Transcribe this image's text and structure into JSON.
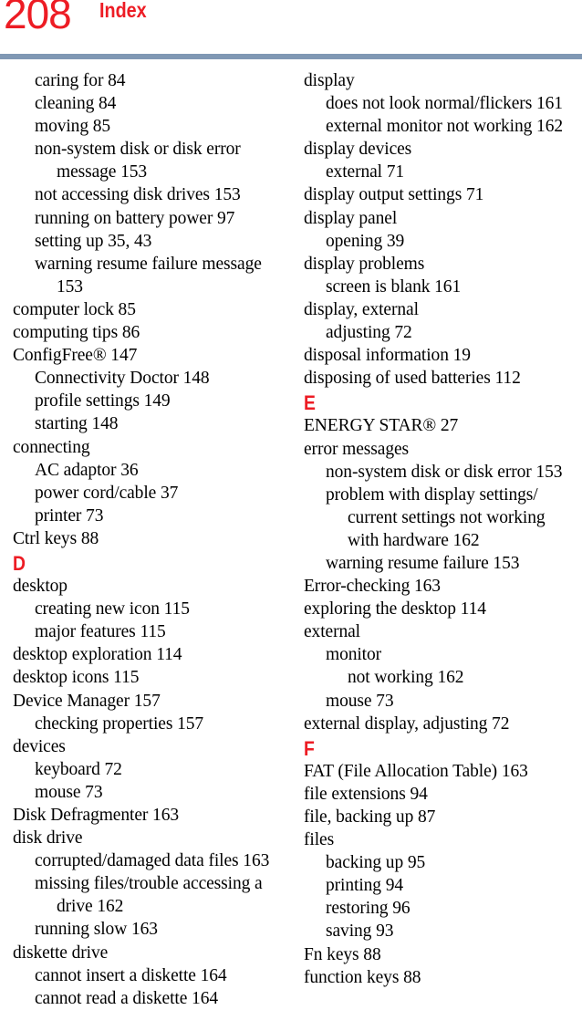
{
  "header": {
    "folio": "208",
    "running_head": "Index",
    "folio_color": "#ed1c24",
    "rule_color": "#8098b4"
  },
  "columns": [
    {
      "name": "left",
      "blocks": [
        {
          "kind": "entry",
          "level": 1,
          "text": "caring for 84",
          "wrapped": false
        },
        {
          "kind": "entry",
          "level": 1,
          "text": "cleaning 84",
          "wrapped": false
        },
        {
          "kind": "entry",
          "level": 1,
          "text": "moving 85",
          "wrapped": false
        },
        {
          "kind": "entry",
          "level": 1,
          "text": "non-system disk or disk error",
          "wrapped": true
        },
        {
          "kind": "cont",
          "level": 1,
          "text": "message 153",
          "wrapped": false
        },
        {
          "kind": "entry",
          "level": 1,
          "text": "not accessing disk drives 153",
          "wrapped": false
        },
        {
          "kind": "entry",
          "level": 1,
          "text": "running on battery power 97",
          "wrapped": false
        },
        {
          "kind": "entry",
          "level": 1,
          "text": "setting up 35, 43",
          "wrapped": false
        },
        {
          "kind": "entry",
          "level": 1,
          "text": "warning resume failure message",
          "wrapped": true
        },
        {
          "kind": "cont",
          "level": 1,
          "text": "153",
          "wrapped": false
        },
        {
          "kind": "entry",
          "level": 0,
          "text": "computer lock 85",
          "wrapped": false
        },
        {
          "kind": "entry",
          "level": 0,
          "text": "computing tips 86",
          "wrapped": false
        },
        {
          "kind": "entry",
          "level": 0,
          "text": "ConfigFree® 147",
          "wrapped": false
        },
        {
          "kind": "entry",
          "level": 1,
          "text": "Connectivity Doctor 148",
          "wrapped": false
        },
        {
          "kind": "entry",
          "level": 1,
          "text": "profile settings 149",
          "wrapped": false
        },
        {
          "kind": "entry",
          "level": 1,
          "text": "starting 148",
          "wrapped": false
        },
        {
          "kind": "entry",
          "level": 0,
          "text": "connecting",
          "wrapped": false
        },
        {
          "kind": "entry",
          "level": 1,
          "text": "AC adaptor 36",
          "wrapped": false
        },
        {
          "kind": "entry",
          "level": 1,
          "text": "power cord/cable 37",
          "wrapped": false
        },
        {
          "kind": "entry",
          "level": 1,
          "text": "printer 73",
          "wrapped": false
        },
        {
          "kind": "entry",
          "level": 0,
          "text": "Ctrl keys 88",
          "wrapped": false
        },
        {
          "kind": "letter",
          "level": 0,
          "text": "D",
          "wrapped": false
        },
        {
          "kind": "entry",
          "level": 0,
          "text": "desktop",
          "wrapped": false
        },
        {
          "kind": "entry",
          "level": 1,
          "text": "creating new icon 115",
          "wrapped": false
        },
        {
          "kind": "entry",
          "level": 1,
          "text": "major features 115",
          "wrapped": false
        },
        {
          "kind": "entry",
          "level": 0,
          "text": "desktop exploration 114",
          "wrapped": false
        },
        {
          "kind": "entry",
          "level": 0,
          "text": "desktop icons 115",
          "wrapped": false
        },
        {
          "kind": "entry",
          "level": 0,
          "text": "Device Manager 157",
          "wrapped": false
        },
        {
          "kind": "entry",
          "level": 1,
          "text": "checking properties 157",
          "wrapped": false
        },
        {
          "kind": "entry",
          "level": 0,
          "text": "devices",
          "wrapped": false
        },
        {
          "kind": "entry",
          "level": 1,
          "text": "keyboard 72",
          "wrapped": false
        },
        {
          "kind": "entry",
          "level": 1,
          "text": "mouse 73",
          "wrapped": false
        },
        {
          "kind": "entry",
          "level": 0,
          "text": "Disk Defragmenter 163",
          "wrapped": false
        },
        {
          "kind": "entry",
          "level": 0,
          "text": "disk drive",
          "wrapped": false
        },
        {
          "kind": "entry",
          "level": 1,
          "text": "corrupted/damaged data files 163",
          "wrapped": false
        },
        {
          "kind": "entry",
          "level": 1,
          "text": "missing files/trouble accessing a",
          "wrapped": true
        },
        {
          "kind": "cont",
          "level": 1,
          "text": "drive 162",
          "wrapped": false
        },
        {
          "kind": "entry",
          "level": 1,
          "text": "running slow 163",
          "wrapped": false
        },
        {
          "kind": "entry",
          "level": 0,
          "text": "diskette drive",
          "wrapped": false
        },
        {
          "kind": "entry",
          "level": 1,
          "text": "cannot insert a diskette 164",
          "wrapped": false
        },
        {
          "kind": "entry",
          "level": 1,
          "text": "cannot read a diskette 164",
          "wrapped": false
        }
      ]
    },
    {
      "name": "right",
      "blocks": [
        {
          "kind": "entry",
          "level": 0,
          "text": "display",
          "wrapped": false
        },
        {
          "kind": "entry",
          "level": 1,
          "text": "does not look normal/flickers 161",
          "wrapped": false
        },
        {
          "kind": "entry",
          "level": 1,
          "text": "external monitor not working 162",
          "wrapped": false
        },
        {
          "kind": "entry",
          "level": 0,
          "text": "display devices",
          "wrapped": false
        },
        {
          "kind": "entry",
          "level": 1,
          "text": "external 71",
          "wrapped": false
        },
        {
          "kind": "entry",
          "level": 0,
          "text": "display output settings 71",
          "wrapped": false
        },
        {
          "kind": "entry",
          "level": 0,
          "text": "display panel",
          "wrapped": false
        },
        {
          "kind": "entry",
          "level": 1,
          "text": "opening 39",
          "wrapped": false
        },
        {
          "kind": "entry",
          "level": 0,
          "text": "display problems",
          "wrapped": false
        },
        {
          "kind": "entry",
          "level": 1,
          "text": "screen is blank 161",
          "wrapped": false
        },
        {
          "kind": "entry",
          "level": 0,
          "text": "display, external",
          "wrapped": false
        },
        {
          "kind": "entry",
          "level": 1,
          "text": "adjusting 72",
          "wrapped": false
        },
        {
          "kind": "entry",
          "level": 0,
          "text": "disposal information 19",
          "wrapped": false
        },
        {
          "kind": "entry",
          "level": 0,
          "text": "disposing of used batteries 112",
          "wrapped": false
        },
        {
          "kind": "letter",
          "level": 0,
          "text": "E",
          "wrapped": false
        },
        {
          "kind": "entry",
          "level": 0,
          "text": "ENERGY STAR® 27",
          "wrapped": false
        },
        {
          "kind": "entry",
          "level": 0,
          "text": "error messages",
          "wrapped": false
        },
        {
          "kind": "entry",
          "level": 1,
          "text": "non-system disk or disk error 153",
          "wrapped": false
        },
        {
          "kind": "entry",
          "level": 1,
          "text": "problem with display settings/",
          "wrapped": true
        },
        {
          "kind": "cont",
          "level": 1,
          "text": "current settings not working",
          "wrapped": true
        },
        {
          "kind": "cont",
          "level": 1,
          "text": "with hardware 162",
          "wrapped": false
        },
        {
          "kind": "entry",
          "level": 1,
          "text": "warning resume failure 153",
          "wrapped": false
        },
        {
          "kind": "entry",
          "level": 0,
          "text": "Error-checking 163",
          "wrapped": false
        },
        {
          "kind": "entry",
          "level": 0,
          "text": "exploring the desktop 114",
          "wrapped": false
        },
        {
          "kind": "entry",
          "level": 0,
          "text": "external",
          "wrapped": false
        },
        {
          "kind": "entry",
          "level": 1,
          "text": "monitor",
          "wrapped": false
        },
        {
          "kind": "entry",
          "level": 2,
          "text": "not working 162",
          "wrapped": false
        },
        {
          "kind": "entry",
          "level": 1,
          "text": "mouse 73",
          "wrapped": false
        },
        {
          "kind": "entry",
          "level": 0,
          "text": "external display, adjusting 72",
          "wrapped": false
        },
        {
          "kind": "letter",
          "level": 0,
          "text": "F",
          "wrapped": false
        },
        {
          "kind": "entry",
          "level": 0,
          "text": "FAT (File Allocation Table) 163",
          "wrapped": false
        },
        {
          "kind": "entry",
          "level": 0,
          "text": "file extensions 94",
          "wrapped": false
        },
        {
          "kind": "entry",
          "level": 0,
          "text": "file, backing up 87",
          "wrapped": false
        },
        {
          "kind": "entry",
          "level": 0,
          "text": "files",
          "wrapped": false
        },
        {
          "kind": "entry",
          "level": 1,
          "text": "backing up 95",
          "wrapped": false
        },
        {
          "kind": "entry",
          "level": 1,
          "text": "printing 94",
          "wrapped": false
        },
        {
          "kind": "entry",
          "level": 1,
          "text": "restoring 96",
          "wrapped": false
        },
        {
          "kind": "entry",
          "level": 1,
          "text": "saving 93",
          "wrapped": false
        },
        {
          "kind": "entry",
          "level": 0,
          "text": "Fn keys 88",
          "wrapped": false
        },
        {
          "kind": "entry",
          "level": 0,
          "text": "function keys 88",
          "wrapped": false
        }
      ]
    }
  ]
}
